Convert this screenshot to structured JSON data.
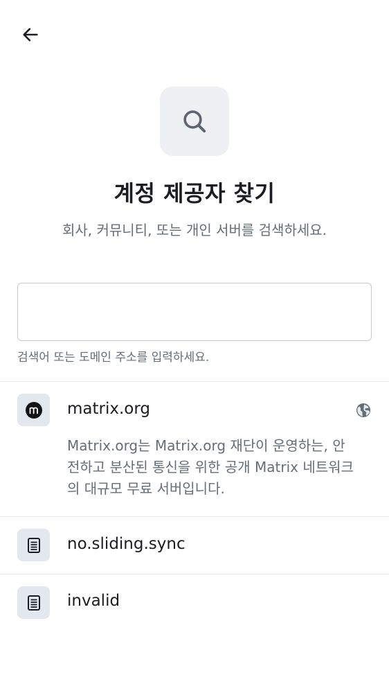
{
  "header": {
    "back_icon": "arrow-left-icon"
  },
  "hero": {
    "icon": "search-icon",
    "title": "계정 제공자 찾기",
    "subtitle": "회사, 커뮤니티, 또는 개인 서버를 검색하세요."
  },
  "search": {
    "value": "",
    "placeholder": "",
    "helper": "검색어 또는 도메인 주소를 입력하세요."
  },
  "results": [
    {
      "name": "matrix.org",
      "icon": "matrix-logo-icon",
      "trailing_icon": "globe-icon",
      "description": "Matrix.org는 Matrix.org 재단이 운영하는, 안전하고 분산된 통신을 위한 공개 Matrix 네트워크의 대규모 무료 서버입니다."
    },
    {
      "name": "no.sliding.sync",
      "icon": "server-icon"
    },
    {
      "name": "invalid",
      "icon": "server-icon"
    }
  ],
  "colors": {
    "icon_bg": "#eef0f4",
    "row_icon_bg": "#e3e7ee",
    "secondary_text": "#656d77",
    "primary_text": "#1b1d22",
    "divider": "#e6e8ec"
  }
}
